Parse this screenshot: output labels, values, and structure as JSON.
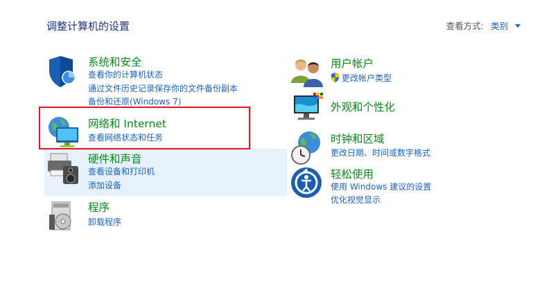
{
  "header": {
    "page_title": "调整计算机的设置",
    "view_by_label": "查看方式:",
    "view_by_value": "类别"
  },
  "left": [
    {
      "title": "系统和安全",
      "links": [
        "查看你的计算机状态",
        "通过文件历史记录保存你的文件备份副本",
        "备份和还原(Windows 7)"
      ]
    },
    {
      "title": "网络和 Internet",
      "links": [
        "查看网络状态和任务"
      ]
    },
    {
      "title": "硬件和声音",
      "links": [
        "查看设备和打印机",
        "添加设备"
      ]
    },
    {
      "title": "程序",
      "links": [
        "卸载程序"
      ]
    }
  ],
  "right": [
    {
      "title": "用户帐户",
      "links": [
        "更改帐户类型"
      ]
    },
    {
      "title": "外观和个性化",
      "links": []
    },
    {
      "title": "时钟和区域",
      "links": [
        "更改日期、时间或数字格式"
      ]
    },
    {
      "title": "轻松使用",
      "links": [
        "使用 Windows 建议的设置",
        "优化视觉显示"
      ]
    }
  ],
  "colors": {
    "title_green": "#0a8a1a",
    "link_blue": "#1a64c8",
    "highlight_red": "#e81123",
    "hover_bg": "#e5f1fb"
  }
}
